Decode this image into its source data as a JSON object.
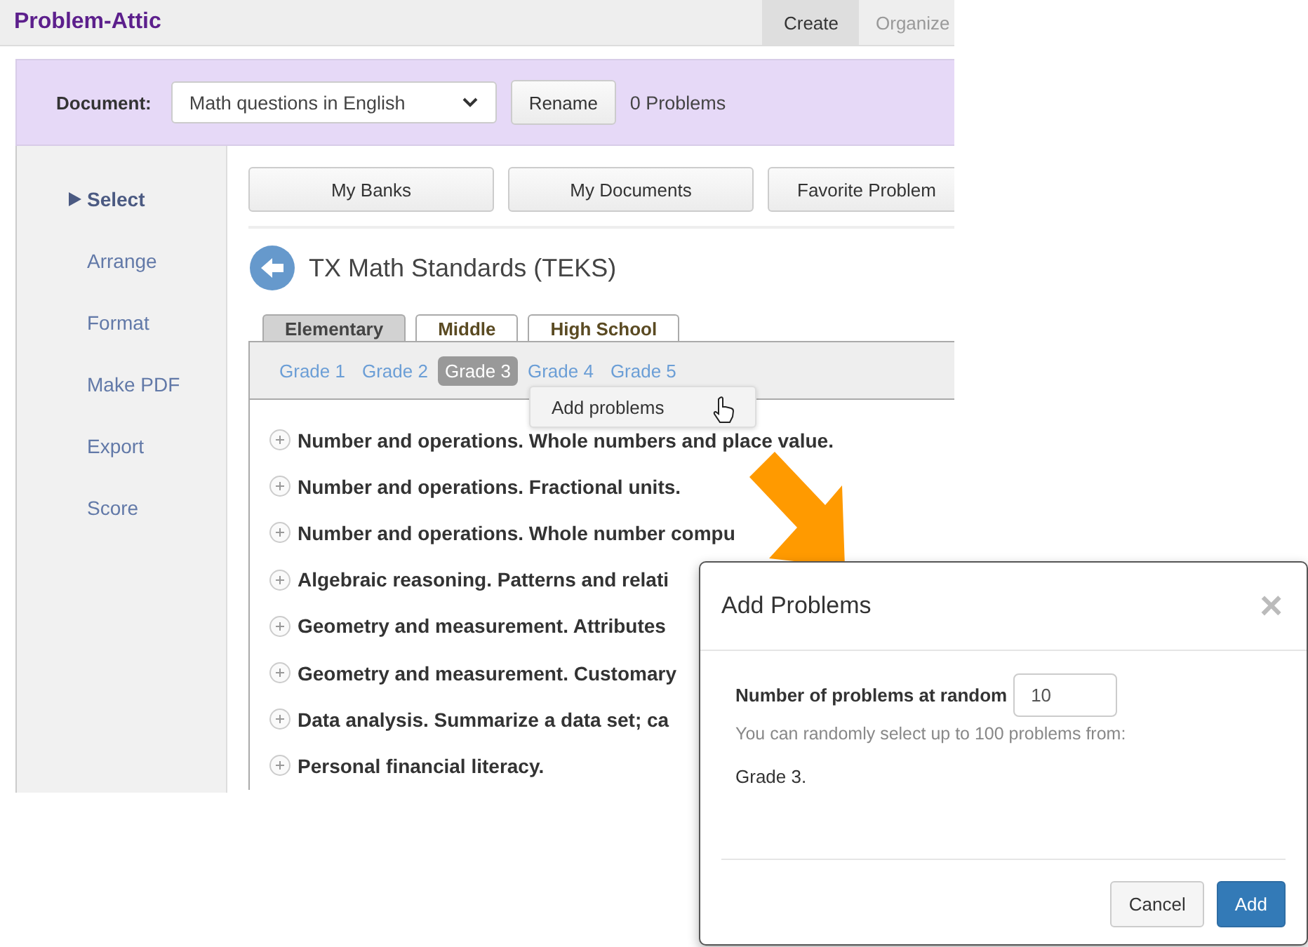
{
  "app": {
    "logo": "Problem-Attic",
    "top_tabs": [
      {
        "label": "Create",
        "selected": true
      },
      {
        "label": "Organize",
        "selected": false
      }
    ],
    "document": {
      "label": "Document:",
      "value": "Math questions in English",
      "rename": "Rename",
      "count": "0 Problems"
    },
    "sidebar": {
      "items": [
        {
          "label": "Select",
          "selected": true
        },
        {
          "label": "Arrange",
          "selected": false
        },
        {
          "label": "Format",
          "selected": false
        },
        {
          "label": "Make PDF",
          "selected": false
        },
        {
          "label": "Export",
          "selected": false
        },
        {
          "label": "Score",
          "selected": false
        }
      ]
    },
    "source_buttons": [
      "My Banks",
      "My Documents",
      "Favorite Problem"
    ],
    "heading": "TX Math Standards (TEKS)",
    "level_tabs": [
      {
        "label": "Elementary",
        "selected": true
      },
      {
        "label": "Middle",
        "selected": false
      },
      {
        "label": "High School",
        "selected": false
      }
    ],
    "grades": [
      {
        "label": "Grade 1",
        "selected": false
      },
      {
        "label": "Grade 2",
        "selected": false
      },
      {
        "label": "Grade 3",
        "selected": true
      },
      {
        "label": "Grade 4",
        "selected": false
      },
      {
        "label": "Grade 5",
        "selected": false
      }
    ],
    "context_menu": {
      "items": [
        "Add problems"
      ]
    },
    "topics": [
      {
        "label": "Number and operations. Whole numbers and place value.",
        "expanded": false
      },
      {
        "label": "Number and operations. Fractional units.",
        "expanded": false
      },
      {
        "label": "Number and operations. Whole number compu",
        "expanded": false
      },
      {
        "label": "Algebraic reasoning. Patterns and relati",
        "expanded": false
      },
      {
        "label": "Geometry and measurement. Attributes",
        "expanded": false
      },
      {
        "label": "Geometry and measurement. Customary",
        "expanded": false
      },
      {
        "label": "Data analysis. Summarize a data set; ca",
        "expanded": false
      },
      {
        "label": "Personal financial literacy.",
        "expanded": false
      }
    ]
  },
  "dialog": {
    "title": "Add Problems",
    "close": "×",
    "field_label": "Number of problems at random",
    "field_value": "10",
    "help": "You can randomly select up to 100 problems from:",
    "source": "Grade 3.",
    "buttons": [
      {
        "label": "Cancel",
        "kind": "default"
      },
      {
        "label": "Add",
        "kind": "primary"
      }
    ]
  }
}
